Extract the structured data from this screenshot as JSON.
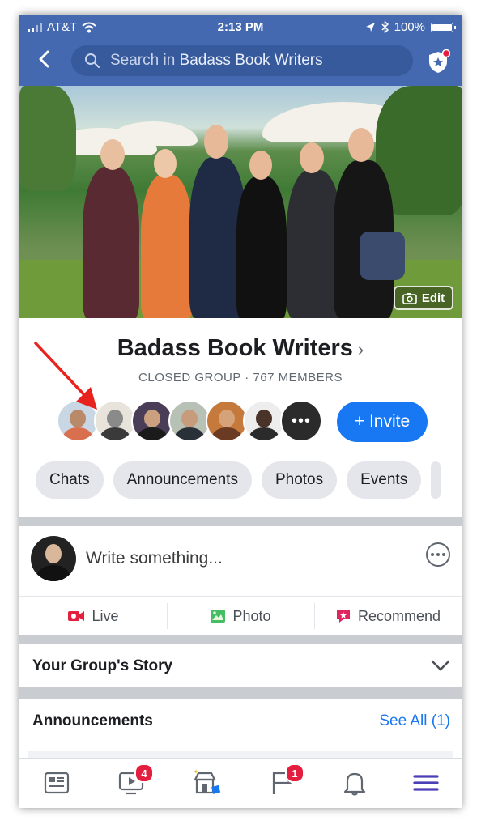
{
  "status_bar": {
    "carrier": "AT&T",
    "time": "2:13 PM",
    "battery": "100%"
  },
  "nav": {
    "search_placeholder_prefix": "Search in ",
    "search_group": "Badass Book Writers"
  },
  "cover": {
    "edit_label": "Edit"
  },
  "group": {
    "name": "Badass Book Writers",
    "subtitle": "CLOSED GROUP · 767 MEMBERS",
    "invite_label": "+ Invite",
    "member_avatars": 7
  },
  "chips": [
    "Chats",
    "Announcements",
    "Photos",
    "Events"
  ],
  "composer": {
    "placeholder": "Write something...",
    "actions": {
      "live": "Live",
      "photo": "Photo",
      "recommend": "Recommend"
    }
  },
  "story": {
    "title": "Your Group's Story"
  },
  "announcements": {
    "title": "Announcements",
    "see_all": "See All (1)"
  },
  "tabbar": {
    "items": [
      "news-feed-icon",
      "watch-icon",
      "marketplace-icon",
      "pages-icon",
      "notifications-icon",
      "menu-icon"
    ],
    "watch_badge": "4",
    "pages_badge": "1"
  },
  "colors": {
    "header": "#4469b0",
    "accent": "#1877f2",
    "badge": "#e41e3f",
    "annotation_arrow": "#e8231e"
  }
}
